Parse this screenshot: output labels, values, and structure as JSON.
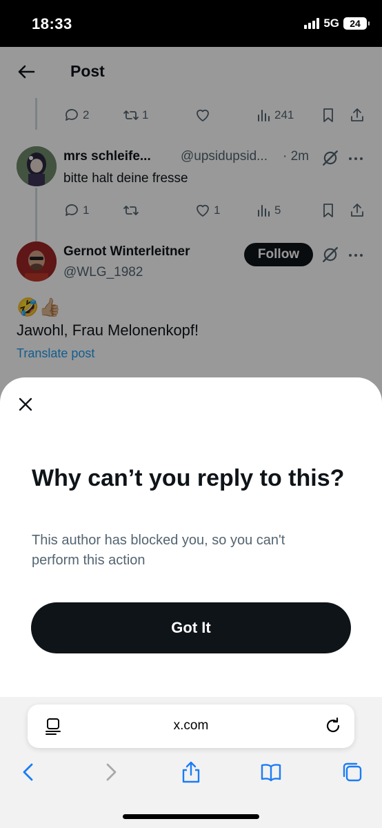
{
  "status_bar": {
    "time": "18:33",
    "network": "5G",
    "battery": "24"
  },
  "header": {
    "title": "Post"
  },
  "first_post_actions": {
    "replies": "2",
    "reposts": "1",
    "likes": "",
    "views": "241"
  },
  "reply": {
    "name": "mrs schleife...",
    "handle": "@upsidupsid...",
    "time": "· 2m",
    "text": "bitte halt deine fresse",
    "actions": {
      "replies": "1",
      "reposts": "",
      "likes": "1",
      "views": "5"
    }
  },
  "author": {
    "name": "Gernot Winterleitner",
    "handle": "@WLG_1982",
    "follow_label": "Follow",
    "emoji": "🤣👍🏼",
    "text": "Jawohl, Frau Melonenkopf!",
    "translate": "Translate post"
  },
  "sheet": {
    "heading": "Why can’t you reply to this?",
    "description": "This author has blocked you, so you can't perform this action",
    "button": "Got It"
  },
  "browser": {
    "url": "x.com"
  },
  "colors": {
    "accent": "#1d9bf0",
    "dark": "#0f1419",
    "muted": "#536471",
    "safari_blue": "#1a7cf5"
  }
}
